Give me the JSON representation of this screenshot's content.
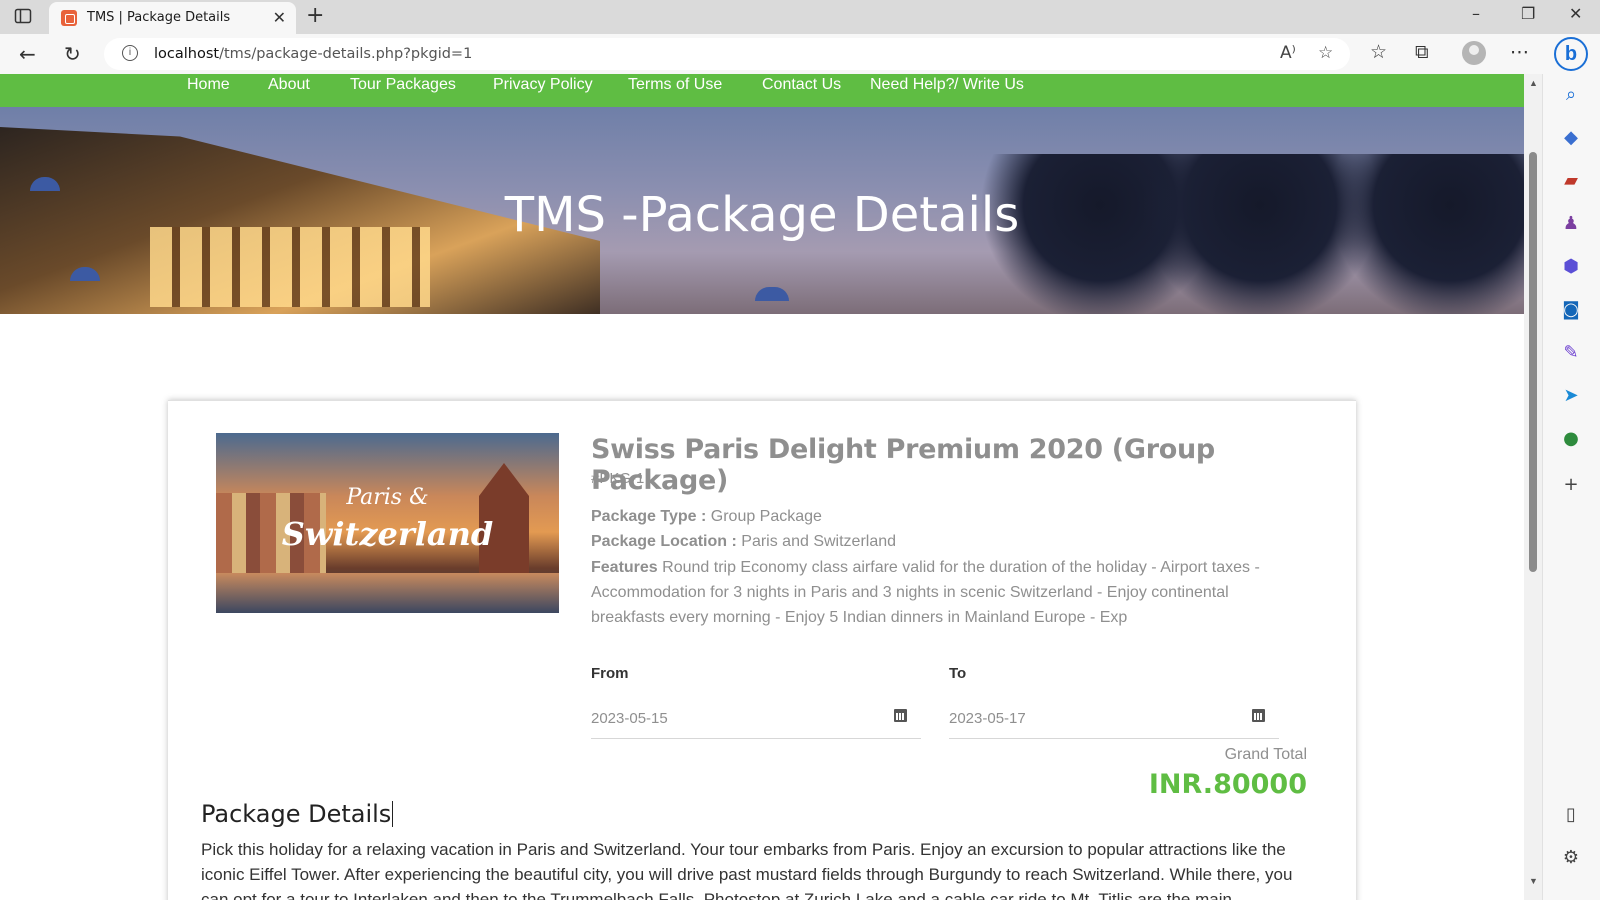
{
  "browser": {
    "tab_title": "TMS | Package Details",
    "url_host": "localhost",
    "url_path": "/tms/package-details.php?pkgid=1"
  },
  "nav": {
    "items": [
      "Home",
      "About",
      "Tour Packages",
      "Privacy Policy",
      "Terms of Use",
      "Contact Us",
      "Need Help?",
      "/ Write Us"
    ]
  },
  "banner": {
    "title": "TMS -Package Details"
  },
  "package": {
    "image_line1": "Paris &",
    "image_line2": "Switzerland",
    "name": "Swiss Paris Delight Premium 2020 (Group Package)",
    "id": "#PKG-1",
    "type_label": "Package Type :",
    "type_value": "Group Package",
    "location_label": "Package Location :",
    "location_value": "Paris and Switzerland",
    "features_label": "Features",
    "features_value": "Round trip Economy class airfare valid for the duration of the holiday - Airport taxes - Accommodation for 3 nights in Paris and 3 nights in scenic Switzerland - Enjoy continental breakfasts every morning - Enjoy 5 Indian dinners in Mainland Europe - Exp",
    "from_label": "From",
    "from_value": "2023-05-15",
    "to_label": "To",
    "to_value": "2023-05-17",
    "grand_total_label": "Grand Total",
    "grand_total_value": "INR.80000",
    "details_heading": "Package Details",
    "details_text": "Pick this holiday for a relaxing vacation in Paris and Switzerland. Your tour embarks from Paris. Enjoy an excursion to popular attractions like the iconic Eiffel Tower. After experiencing the beautiful city, you will drive past mustard fields through Burgundy to reach Switzerland. While there, you can opt for a tour to Interlaken and then to the Trummelbach Falls. Photostop at Zurich Lake and a cable car ride to Mt. Titlis are the main"
  },
  "colors": {
    "nav_green": "#5fbd43",
    "price_green": "#5fbd43",
    "muted_text": "#8f8f8f"
  },
  "icons": [
    "sidebar-toggle-icon",
    "favicon-icon",
    "close-icon",
    "plus-icon",
    "back-icon",
    "refresh-icon",
    "info-icon",
    "read-aloud-icon",
    "favorite-add-icon",
    "favorites-icon",
    "collections-icon",
    "profile-icon",
    "more-icon",
    "bing-icon",
    "calendar-icon"
  ]
}
